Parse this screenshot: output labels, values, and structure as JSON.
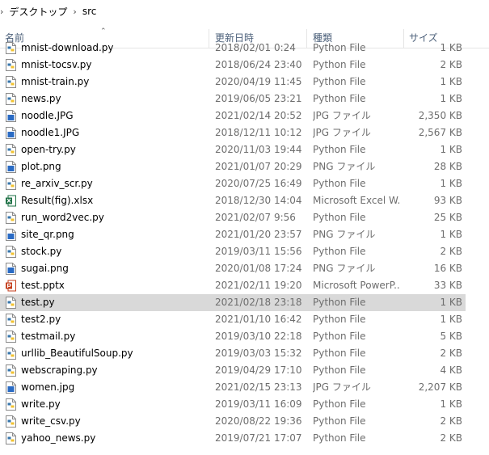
{
  "breadcrumb": {
    "items": [
      "デスクトップ",
      "src"
    ]
  },
  "columns": {
    "name": "名前",
    "date": "更新日時",
    "type": "種類",
    "size": "サイズ"
  },
  "files": [
    {
      "name": "mnist-download.py",
      "date": "2018/02/01 0:24",
      "type": "Python File",
      "size": "1 KB",
      "icon": "python-file-icon",
      "selected": false
    },
    {
      "name": "mnist-tocsv.py",
      "date": "2018/06/24 23:40",
      "type": "Python File",
      "size": "2 KB",
      "icon": "python-file-icon",
      "selected": false
    },
    {
      "name": "mnist-train.py",
      "date": "2020/04/19 11:45",
      "type": "Python File",
      "size": "1 KB",
      "icon": "python-file-icon",
      "selected": false
    },
    {
      "name": "news.py",
      "date": "2019/06/05 23:21",
      "type": "Python File",
      "size": "1 KB",
      "icon": "python-file-icon",
      "selected": false
    },
    {
      "name": "noodle.JPG",
      "date": "2021/02/14 20:52",
      "type": "JPG ファイル",
      "size": "2,350 KB",
      "icon": "image-file-icon",
      "selected": false
    },
    {
      "name": "noodle1.JPG",
      "date": "2018/12/11 10:12",
      "type": "JPG ファイル",
      "size": "2,567 KB",
      "icon": "image-file-icon",
      "selected": false
    },
    {
      "name": "open-try.py",
      "date": "2020/11/03 19:44",
      "type": "Python File",
      "size": "1 KB",
      "icon": "python-file-icon",
      "selected": false
    },
    {
      "name": "plot.png",
      "date": "2021/01/07 20:29",
      "type": "PNG ファイル",
      "size": "28 KB",
      "icon": "image-file-icon",
      "selected": false
    },
    {
      "name": "re_arxiv_scr.py",
      "date": "2020/07/25 16:49",
      "type": "Python File",
      "size": "1 KB",
      "icon": "python-file-icon",
      "selected": false
    },
    {
      "name": "Result(fig).xlsx",
      "date": "2018/12/30 14:04",
      "type": "Microsoft Excel W...",
      "size": "93 KB",
      "icon": "excel-file-icon",
      "selected": false
    },
    {
      "name": "run_word2vec.py",
      "date": "2021/02/07 9:56",
      "type": "Python File",
      "size": "25 KB",
      "icon": "python-file-icon",
      "selected": false
    },
    {
      "name": "site_qr.png",
      "date": "2021/01/20 23:57",
      "type": "PNG ファイル",
      "size": "1 KB",
      "icon": "image-file-icon",
      "selected": false
    },
    {
      "name": "stock.py",
      "date": "2019/03/11 15:56",
      "type": "Python File",
      "size": "2 KB",
      "icon": "python-file-icon",
      "selected": false
    },
    {
      "name": "sugai.png",
      "date": "2020/01/08 17:24",
      "type": "PNG ファイル",
      "size": "16 KB",
      "icon": "image-file-icon",
      "selected": false
    },
    {
      "name": "test.pptx",
      "date": "2021/02/11 19:20",
      "type": "Microsoft PowerP...",
      "size": "33 KB",
      "icon": "powerpoint-file-icon",
      "selected": false
    },
    {
      "name": "test.py",
      "date": "2021/02/18 23:18",
      "type": "Python File",
      "size": "1 KB",
      "icon": "python-file-icon",
      "selected": true
    },
    {
      "name": "test2.py",
      "date": "2021/01/10 16:42",
      "type": "Python File",
      "size": "1 KB",
      "icon": "python-file-icon",
      "selected": false
    },
    {
      "name": "testmail.py",
      "date": "2019/03/10 22:18",
      "type": "Python File",
      "size": "5 KB",
      "icon": "python-file-icon",
      "selected": false
    },
    {
      "name": "urllib_BeautifulSoup.py",
      "date": "2019/03/03 15:32",
      "type": "Python File",
      "size": "2 KB",
      "icon": "python-file-icon",
      "selected": false
    },
    {
      "name": "webscraping.py",
      "date": "2019/04/29 17:10",
      "type": "Python File",
      "size": "4 KB",
      "icon": "python-file-icon",
      "selected": false
    },
    {
      "name": "women.jpg",
      "date": "2021/02/15 23:13",
      "type": "JPG ファイル",
      "size": "2,207 KB",
      "icon": "image-file-icon",
      "selected": false
    },
    {
      "name": "write.py",
      "date": "2019/03/11 16:09",
      "type": "Python File",
      "size": "1 KB",
      "icon": "python-file-icon",
      "selected": false
    },
    {
      "name": "write_csv.py",
      "date": "2020/08/22 19:36",
      "type": "Python File",
      "size": "2 KB",
      "icon": "python-file-icon",
      "selected": false
    },
    {
      "name": "yahoo_news.py",
      "date": "2019/07/21 17:07",
      "type": "Python File",
      "size": "2 KB",
      "icon": "python-file-icon",
      "selected": false
    }
  ]
}
